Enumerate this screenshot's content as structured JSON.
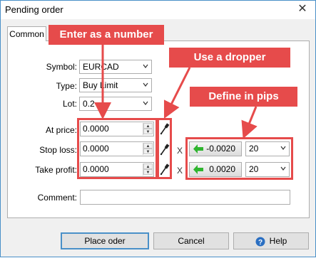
{
  "window": {
    "title": "Pending order",
    "close_glyph": "✕"
  },
  "tabs": [
    {
      "label": "Common"
    }
  ],
  "form": {
    "symbol": {
      "label": "Symbol:",
      "value": "EURCAD"
    },
    "type": {
      "label": "Type:",
      "value": "Buy Limit"
    },
    "lot": {
      "label": "Lot:",
      "value": "0.2"
    },
    "at_price": {
      "label": "At price:",
      "value": "0.0000"
    },
    "stop_loss": {
      "label": "Stop loss:",
      "value": "0.0000",
      "pips_offset": "-0.0020",
      "pips": "20"
    },
    "take_profit": {
      "label": "Take profit:",
      "value": "0.0000",
      "pips_offset": "0.0020",
      "pips": "20"
    },
    "comment": {
      "label": "Comment:",
      "value": ""
    },
    "x_glyph": "X"
  },
  "buttons": {
    "place": "Place oder",
    "cancel": "Cancel",
    "help": "Help"
  },
  "annotations": {
    "number": "Enter as a number",
    "dropper": "Use a dropper",
    "pips": "Define in pips"
  },
  "colors": {
    "annotation": "#e64b4b",
    "accent": "#4a90c8",
    "green_arrow": "#2fb52f",
    "help_icon": "#2a6fc2"
  }
}
